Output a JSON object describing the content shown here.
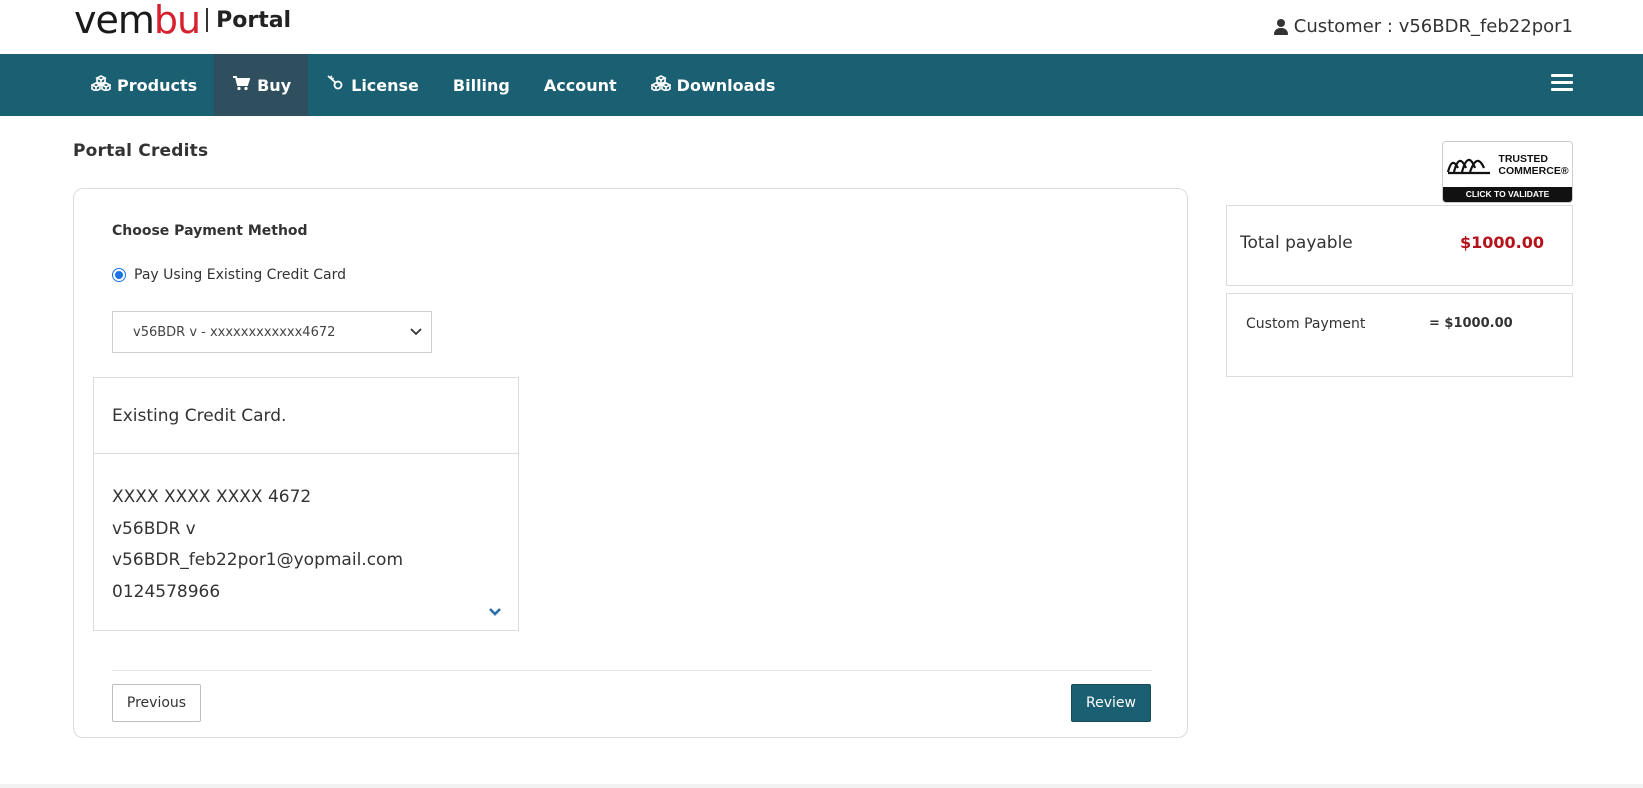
{
  "header": {
    "logo_text_a": "vem",
    "logo_text_b": "bu",
    "logo_portal": "Portal",
    "customer": "Customer : v56BDR_feb22por1"
  },
  "nav": {
    "items": [
      {
        "label": "Products",
        "icon": "cubes-icon"
      },
      {
        "label": "Buy",
        "icon": "cart-icon",
        "active": true
      },
      {
        "label": "License",
        "icon": "key-icon"
      },
      {
        "label": "Billing"
      },
      {
        "label": "Account"
      },
      {
        "label": "Downloads",
        "icon": "cubes-icon"
      }
    ]
  },
  "page": {
    "title": "Portal Credits"
  },
  "payment": {
    "section_label": "Choose Payment Method",
    "radio_label": "Pay Using Existing Credit Card",
    "selected_card": "v56BDR v - xxxxxxxxxxxx4672",
    "card_panel": {
      "title": "Existing Credit Card.",
      "number": "XXXX XXXX XXXX 4672",
      "name": "v56BDR v",
      "email": "v56BDR_feb22por1@yopmail.com",
      "phone": "0124578966"
    },
    "previous_label": "Previous",
    "review_label": "Review"
  },
  "badge": {
    "line1": "TRUSTED",
    "line2": "COMMERCE®",
    "cta": "CLICK TO VALIDATE"
  },
  "summary": {
    "total_label": "Total payable",
    "total_value": "$1000.00",
    "custom_label": "Custom Payment",
    "custom_value": "= $1000.00"
  },
  "colors": {
    "nav_bg": "#1a5f72",
    "nav_active": "#2f4e5e",
    "price_red": "#b5121b",
    "radio_blue": "#1a73e8"
  }
}
